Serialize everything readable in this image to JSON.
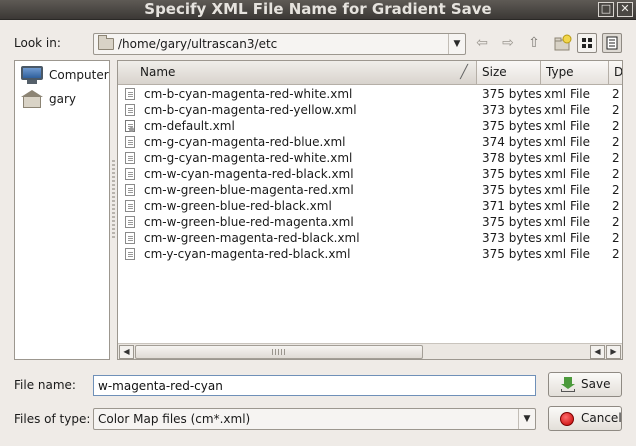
{
  "window": {
    "title": "Specify XML File Name for Gradient Save",
    "minimize_glyph": "□",
    "close_glyph": "✕"
  },
  "lookin": {
    "label": "Look in:",
    "path": "/home/gary/ultrascan3/etc",
    "arrow_glyph": "▼"
  },
  "toolbar": {
    "back_glyph": "⇦",
    "forward_glyph": "⇨",
    "up_glyph": "⇧"
  },
  "sidebar": {
    "items": [
      {
        "label": "Computer",
        "icon": "computer-icon"
      },
      {
        "label": "gary",
        "icon": "home-folder-icon"
      }
    ]
  },
  "filelist": {
    "headers": {
      "name": "Name",
      "size": "Size",
      "type": "Type",
      "date": "Date Modified"
    },
    "sort_glyph": "╱",
    "rows": [
      {
        "name": "cm-b-cyan-magenta-red-white.xml",
        "size": "375 bytes",
        "type": "xml File",
        "date": "2"
      },
      {
        "name": "cm-b-cyan-magenta-red-yellow.xml",
        "size": "373 bytes",
        "type": "xml File",
        "date": "2"
      },
      {
        "name": "cm-default.xml",
        "size": "375 bytes",
        "type": "xml File",
        "date": "2"
      },
      {
        "name": "cm-g-cyan-magenta-red-blue.xml",
        "size": "374 bytes",
        "type": "xml File",
        "date": "2"
      },
      {
        "name": "cm-g-cyan-magenta-red-white.xml",
        "size": "378 bytes",
        "type": "xml File",
        "date": "2"
      },
      {
        "name": "cm-w-cyan-magenta-red-black.xml",
        "size": "375 bytes",
        "type": "xml File",
        "date": "2"
      },
      {
        "name": "cm-w-green-blue-magenta-red.xml",
        "size": "375 bytes",
        "type": "xml File",
        "date": "2"
      },
      {
        "name": "cm-w-green-blue-red-black.xml",
        "size": "371 bytes",
        "type": "xml File",
        "date": "2"
      },
      {
        "name": "cm-w-green-blue-red-magenta.xml",
        "size": "375 bytes",
        "type": "xml File",
        "date": "2"
      },
      {
        "name": "cm-w-green-magenta-red-black.xml",
        "size": "373 bytes",
        "type": "xml File",
        "date": "2"
      },
      {
        "name": "cm-y-cyan-magenta-red-black.xml",
        "size": "375 bytes",
        "type": "xml File",
        "date": "2"
      }
    ]
  },
  "scrollbar": {
    "left_glyph": "◀",
    "right_glyph": "▶"
  },
  "filename": {
    "label": "File name:",
    "value": "w-magenta-red-cyan"
  },
  "filetype": {
    "label": "Files of type:",
    "value": "Color Map files (cm*.xml)",
    "arrow_glyph": "▼"
  },
  "buttons": {
    "save": "Save",
    "cancel": "Cancel"
  }
}
